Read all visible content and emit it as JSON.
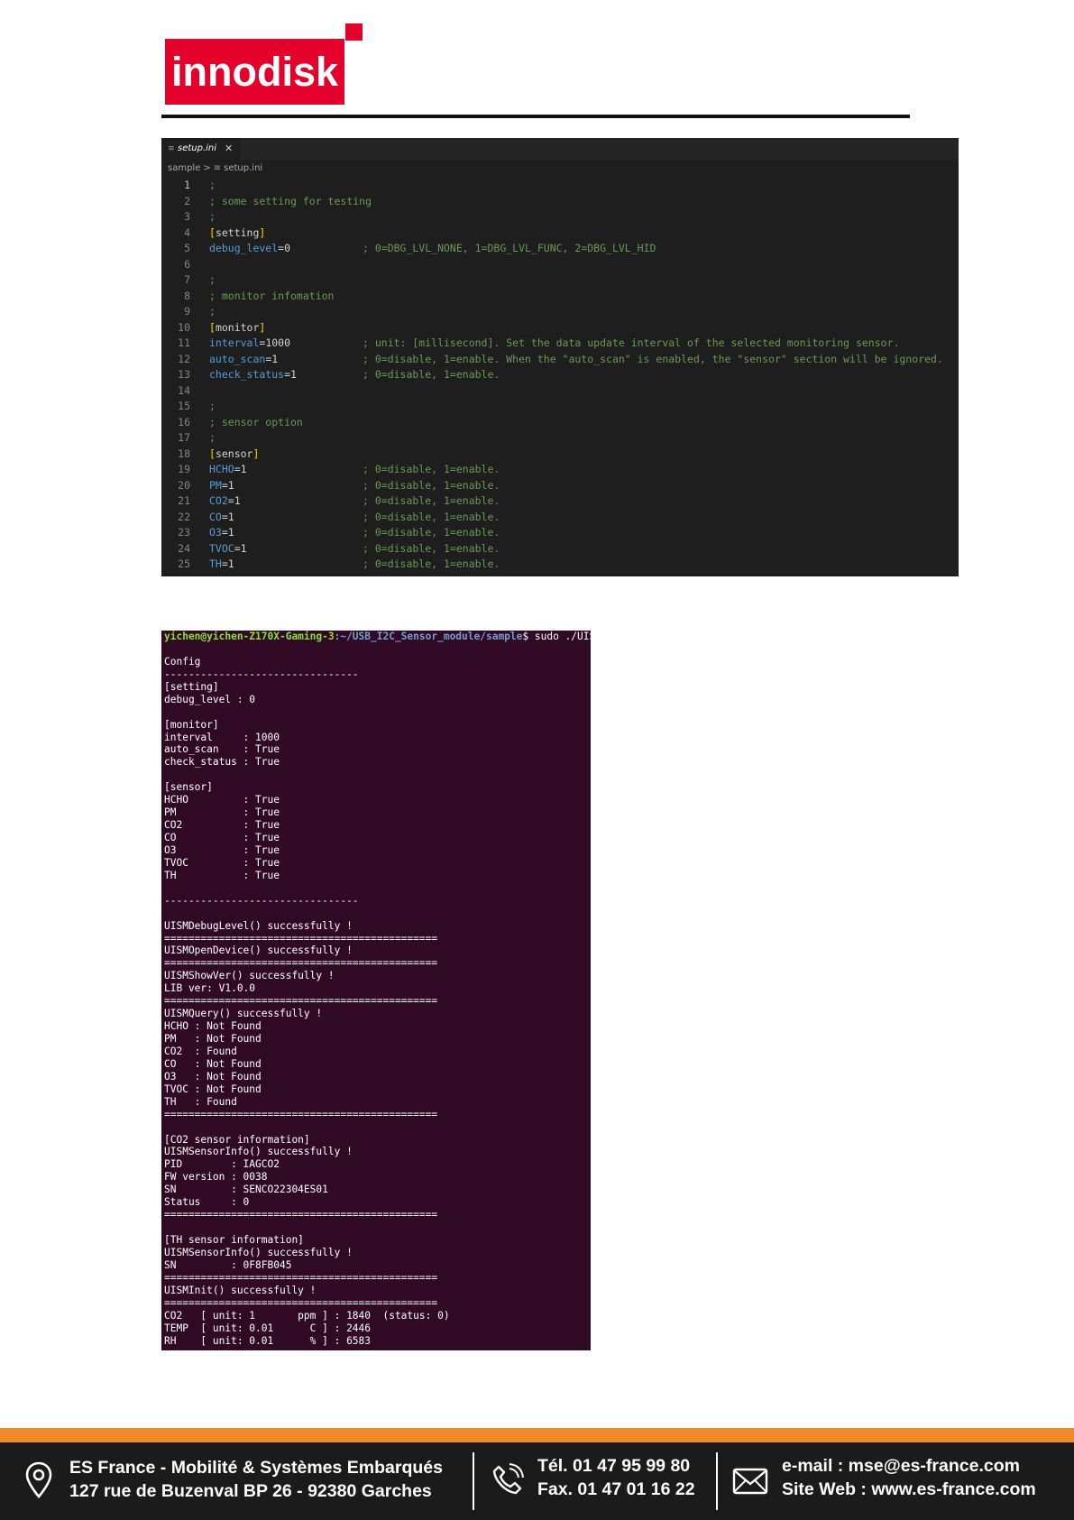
{
  "logo": {
    "text": "innodisk"
  },
  "editor": {
    "tab_name": "setup.ini",
    "tab_close": "✕",
    "breadcrumb": [
      "sample",
      ">",
      "setup.ini"
    ],
    "lines": [
      {
        "n": "1",
        "parts": [
          [
            "cmt",
            ";"
          ]
        ],
        "comment": ""
      },
      {
        "n": "2",
        "parts": [
          [
            "cmt",
            "; some setting for testing"
          ]
        ],
        "comment": ""
      },
      {
        "n": "3",
        "parts": [
          [
            "cmt",
            ";"
          ]
        ],
        "comment": ""
      },
      {
        "n": "4",
        "parts": [
          [
            "br",
            "["
          ],
          [
            "sec",
            "setting"
          ],
          [
            "br",
            "]"
          ]
        ],
        "comment": ""
      },
      {
        "n": "5",
        "parts": [
          [
            "key",
            "debug_level"
          ],
          [
            "val",
            "=0"
          ]
        ],
        "comment": "; 0=DBG_LVL_NONE, 1=DBG_LVL_FUNC, 2=DBG_LVL_HID"
      },
      {
        "n": "6",
        "parts": [],
        "comment": ""
      },
      {
        "n": "7",
        "parts": [
          [
            "cmt",
            ";"
          ]
        ],
        "comment": ""
      },
      {
        "n": "8",
        "parts": [
          [
            "cmt",
            "; monitor infomation"
          ]
        ],
        "comment": ""
      },
      {
        "n": "9",
        "parts": [
          [
            "cmt",
            ";"
          ]
        ],
        "comment": ""
      },
      {
        "n": "10",
        "parts": [
          [
            "br",
            "["
          ],
          [
            "sec",
            "monitor"
          ],
          [
            "br",
            "]"
          ]
        ],
        "comment": ""
      },
      {
        "n": "11",
        "parts": [
          [
            "key",
            "interval"
          ],
          [
            "val",
            "=1000"
          ]
        ],
        "comment": "; unit: [millisecond]. Set the data update interval of the selected monitoring sensor."
      },
      {
        "n": "12",
        "parts": [
          [
            "key",
            "auto_scan"
          ],
          [
            "val",
            "=1"
          ]
        ],
        "comment": "; 0=disable, 1=enable. When the \"auto_scan\" is enabled, the \"sensor\" section will be ignored."
      },
      {
        "n": "13",
        "parts": [
          [
            "key",
            "check_status"
          ],
          [
            "val",
            "=1"
          ]
        ],
        "comment": "; 0=disable, 1=enable."
      },
      {
        "n": "14",
        "parts": [],
        "comment": ""
      },
      {
        "n": "15",
        "parts": [
          [
            "cmt",
            ";"
          ]
        ],
        "comment": ""
      },
      {
        "n": "16",
        "parts": [
          [
            "cmt",
            "; sensor option"
          ]
        ],
        "comment": ""
      },
      {
        "n": "17",
        "parts": [
          [
            "cmt",
            ";"
          ]
        ],
        "comment": ""
      },
      {
        "n": "18",
        "parts": [
          [
            "br",
            "["
          ],
          [
            "sec",
            "sensor"
          ],
          [
            "br",
            "]"
          ]
        ],
        "comment": ""
      },
      {
        "n": "19",
        "parts": [
          [
            "key",
            "HCHO"
          ],
          [
            "val",
            "=1"
          ]
        ],
        "comment": "; 0=disable, 1=enable."
      },
      {
        "n": "20",
        "parts": [
          [
            "key",
            "PM"
          ],
          [
            "val",
            "=1"
          ]
        ],
        "comment": "; 0=disable, 1=enable."
      },
      {
        "n": "21",
        "parts": [
          [
            "key",
            "CO2"
          ],
          [
            "val",
            "=1"
          ]
        ],
        "comment": "; 0=disable, 1=enable."
      },
      {
        "n": "22",
        "parts": [
          [
            "key",
            "CO"
          ],
          [
            "val",
            "=1"
          ]
        ],
        "comment": "; 0=disable, 1=enable."
      },
      {
        "n": "23",
        "parts": [
          [
            "key",
            "O3"
          ],
          [
            "val",
            "=1"
          ]
        ],
        "comment": "; 0=disable, 1=enable."
      },
      {
        "n": "24",
        "parts": [
          [
            "key",
            "TVOC"
          ],
          [
            "val",
            "=1"
          ]
        ],
        "comment": "; 0=disable, 1=enable."
      },
      {
        "n": "25",
        "parts": [
          [
            "key",
            "TH"
          ],
          [
            "val",
            "=1"
          ]
        ],
        "comment": "; 0=disable, 1=enable."
      }
    ]
  },
  "terminal": {
    "prompt_user": "yichen@yichen-Z170X-Gaming-3",
    "prompt_path": ":~/USB_I2C_Sensor_module/sample",
    "prompt_cmd": "$ sudo ./UISM",
    "lines": [
      "",
      "Config",
      "--------------------------------",
      "[setting]",
      "debug_level : 0",
      "",
      "[monitor]",
      "interval     : 1000",
      "auto_scan    : True",
      "check_status : True",
      "",
      "[sensor]",
      "HCHO         : True",
      "PM           : True",
      "CO2          : True",
      "CO           : True",
      "O3           : True",
      "TVOC         : True",
      "TH           : True",
      "",
      "--------------------------------",
      "",
      "UISMDebugLevel() successfully !",
      "=============================================",
      "UISMOpenDevice() successfully !",
      "=============================================",
      "UISMShowVer() successfully !",
      "LIB ver: V1.0.0",
      "=============================================",
      "UISMQuery() successfully !",
      "HCHO : Not Found",
      "PM   : Not Found",
      "CO2  : Found",
      "CO   : Not Found",
      "O3   : Not Found",
      "TVOC : Not Found",
      "TH   : Found",
      "=============================================",
      "",
      "[CO2 sensor information]",
      "UISMSensorInfo() successfully !",
      "PID        : IAGCO2",
      "FW version : 0038",
      "SN         : SENCO22304ES01",
      "Status     : 0",
      "=============================================",
      "",
      "[TH sensor information]",
      "UISMSensorInfo() successfully !",
      "SN         : 0F8FB045",
      "=============================================",
      "UISMInit() successfully !",
      "=============================================",
      "CO2   [ unit: 1       ppm ] : 1840  (status: 0)",
      "TEMP  [ unit: 0.01      C ] : 2446",
      "RH    [ unit: 0.01      % ] : 6583"
    ]
  },
  "footer": {
    "company": "ES France - Mobilité & Systèmes Embarqués",
    "address": "127 rue de Buzenval BP 26 - 92380 Garches",
    "tel": "Tél. 01 47 95 99 80",
    "fax": "Fax. 01 47 01 16 22",
    "email": "e-mail : mse@es-france.com",
    "web": "Site Web : www.es-france.com",
    "icons": [
      "location-pin-icon",
      "phone-icon",
      "envelope-icon"
    ],
    "colors": {
      "orange": "#f28a29",
      "dark": "#1b1b1b"
    }
  }
}
